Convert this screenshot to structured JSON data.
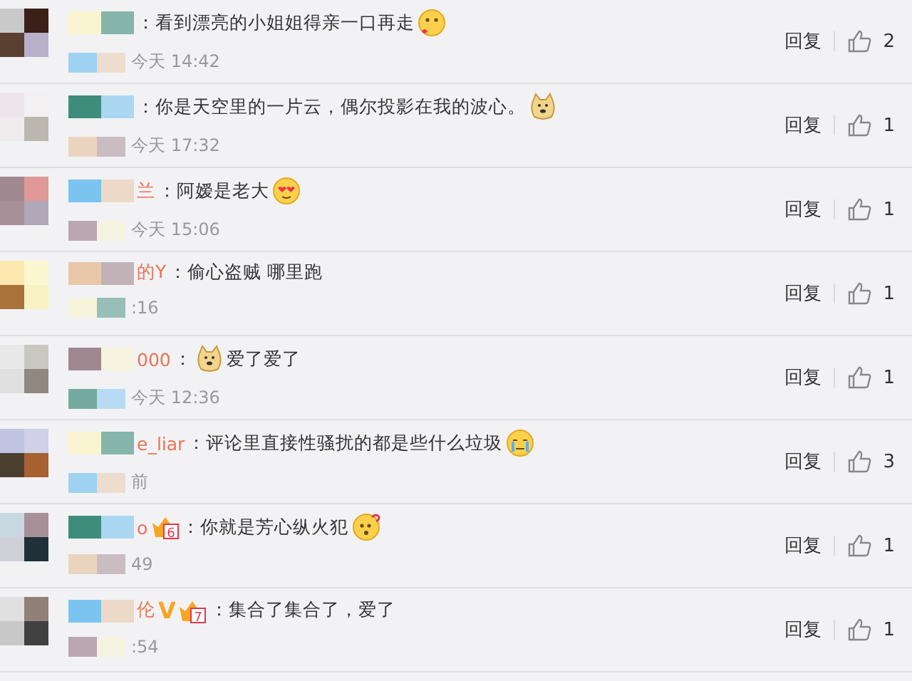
{
  "comments": [
    {
      "parts": [
        {
          "kind": "text",
          "text": "：看到漂亮的小姐姐得亲一口再走"
        },
        {
          "kind": "blush"
        }
      ],
      "time": "今天 14:42",
      "reply": "回复",
      "likes": "2"
    },
    {
      "parts": [
        {
          "kind": "text",
          "text": "：你是天空里的一片云，偶尔投影在我的波心。"
        },
        {
          "kind": "doge"
        }
      ],
      "time": "今天 17:32",
      "reply": "回复",
      "likes": "1"
    },
    {
      "name": "兰",
      "parts": [
        {
          "kind": "text",
          "text": "：阿嫒是老大"
        },
        {
          "kind": "hearteyes"
        }
      ],
      "time": "今天 15:06",
      "reply": "回复",
      "likes": "1"
    },
    {
      "name": "的Y",
      "parts": [
        {
          "kind": "text",
          "text": "：偷心盗贼 哪里跑"
        }
      ],
      "time": ":16",
      "reply": "回复",
      "likes": "1"
    },
    {
      "name": "000",
      "parts": [
        {
          "kind": "text",
          "text": "："
        },
        {
          "kind": "doge"
        },
        {
          "kind": "text",
          "text": "爱了爱了"
        }
      ],
      "time": "今天 12:36",
      "reply": "回复",
      "likes": "1"
    },
    {
      "name": "e_liar",
      "parts": [
        {
          "kind": "text",
          "text": "：评论里直接性骚扰的都是些什么垃圾"
        },
        {
          "kind": "crying"
        }
      ],
      "time": "前",
      "reply": "回复",
      "likes": "3"
    },
    {
      "name": "o",
      "badges": [
        {
          "kind": "crown",
          "text": "6"
        }
      ],
      "parts": [
        {
          "kind": "text",
          "text": "：你就是芳心纵火犯"
        },
        {
          "kind": "puzzled"
        }
      ],
      "time": "49",
      "reply": "回复",
      "likes": "1"
    },
    {
      "name": "伦",
      "badges": [
        {
          "kind": "vip",
          "text": "V"
        },
        {
          "kind": "crown",
          "text": "7"
        }
      ],
      "parts": [
        {
          "kind": "text",
          "text": "：集合了集合了，爱了"
        }
      ],
      "time": ":54",
      "reply": "回复",
      "likes": "1"
    }
  ]
}
